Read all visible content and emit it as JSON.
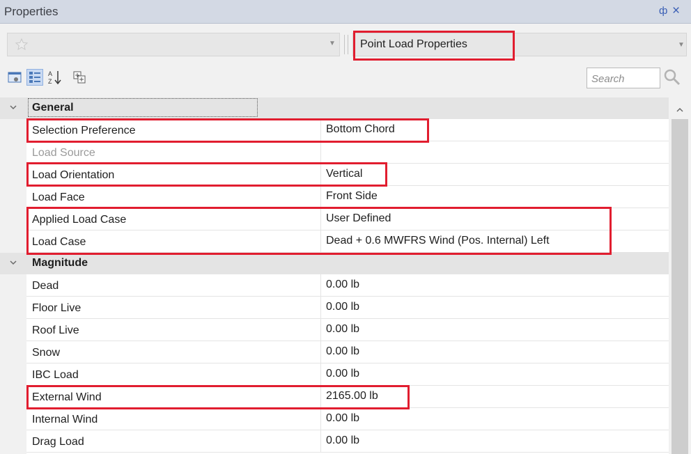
{
  "panel": {
    "title": "Properties",
    "pin_glyph": "ф",
    "close_glyph": "×"
  },
  "toolbar": {
    "object_combo_value": "",
    "type_combo_value": "Point Load Properties",
    "buttons": [
      {
        "name": "categorized-view-icon",
        "active": false
      },
      {
        "name": "property-pages-icon",
        "active": true
      },
      {
        "name": "sort-alphabetical-icon",
        "active": false
      },
      {
        "name": "expand-all-icon",
        "active": false
      }
    ],
    "search_placeholder": "Search"
  },
  "grid": {
    "categories": [
      {
        "name": "General",
        "rows": [
          {
            "name": "Selection Preference",
            "value": "Bottom Chord"
          },
          {
            "name": "Load Source",
            "value": "",
            "disabled": true
          },
          {
            "name": "Load Orientation",
            "value": "Vertical"
          },
          {
            "name": "Load Face",
            "value": "Front Side"
          },
          {
            "name": "Applied Load Case",
            "value": "User Defined"
          },
          {
            "name": "Load Case",
            "value": "Dead + 0.6 MWFRS Wind (Pos. Internal) Left"
          }
        ]
      },
      {
        "name": "Magnitude",
        "rows": [
          {
            "name": "Dead",
            "value": "0.00 lb"
          },
          {
            "name": "Floor Live",
            "value": "0.00 lb"
          },
          {
            "name": "Roof Live",
            "value": "0.00 lb"
          },
          {
            "name": "Snow",
            "value": "0.00 lb"
          },
          {
            "name": "IBC Load",
            "value": "0.00 lb"
          },
          {
            "name": "External Wind",
            "value": "2165.00 lb"
          },
          {
            "name": "Internal Wind",
            "value": "0.00 lb"
          },
          {
            "name": "Drag Load",
            "value": "0.00 lb"
          }
        ]
      }
    ]
  },
  "colors": {
    "highlight": "#e11d2f",
    "title_bar": "#d3d9e4",
    "category_band": "#e4e4e4"
  }
}
